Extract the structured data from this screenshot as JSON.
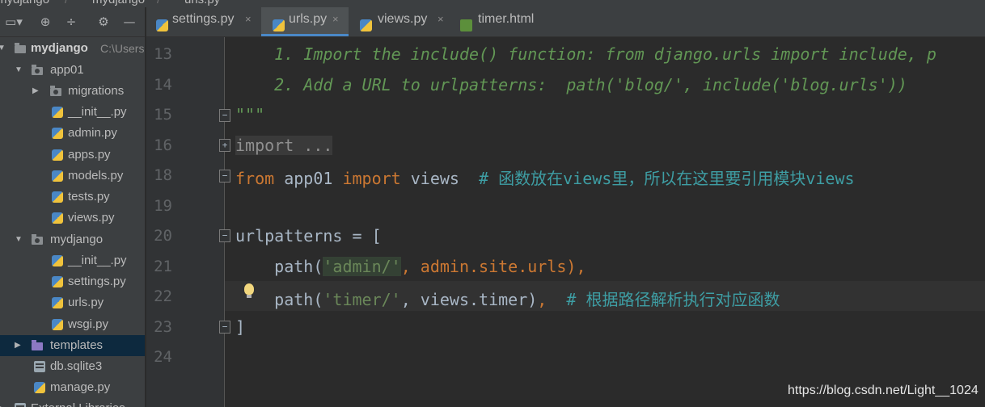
{
  "breadcrumb": [
    "mydjango",
    "mydjango",
    "urls.py"
  ],
  "project_toolbar": {
    "target_icon": "target-icon",
    "collapse_icon": "collapse-all-icon",
    "settings_icon": "gear-icon",
    "hide_icon": "minimize-icon"
  },
  "tree": [
    {
      "label": "mydjango",
      "extra": "C:\\Users",
      "type": "project-root",
      "icon": "folder-icon"
    },
    {
      "label": "app01",
      "type": "package",
      "icon": "package-folder-icon"
    },
    {
      "label": "migrations",
      "type": "package",
      "icon": "package-folder-icon"
    },
    {
      "label": "__init__.py",
      "type": "file",
      "icon": "python-file-icon"
    },
    {
      "label": "admin.py",
      "type": "file",
      "icon": "python-file-icon"
    },
    {
      "label": "apps.py",
      "type": "file",
      "icon": "python-file-icon"
    },
    {
      "label": "models.py",
      "type": "file",
      "icon": "python-file-icon"
    },
    {
      "label": "tests.py",
      "type": "file",
      "icon": "python-file-icon"
    },
    {
      "label": "views.py",
      "type": "file",
      "icon": "python-file-icon"
    },
    {
      "label": "mydjango",
      "type": "package",
      "icon": "package-folder-icon"
    },
    {
      "label": "__init__.py",
      "type": "file",
      "icon": "python-file-icon"
    },
    {
      "label": "settings.py",
      "type": "file",
      "icon": "python-file-icon"
    },
    {
      "label": "urls.py",
      "type": "file",
      "icon": "python-file-icon"
    },
    {
      "label": "wsgi.py",
      "type": "file",
      "icon": "python-file-icon"
    },
    {
      "label": "templates",
      "type": "folder",
      "icon": "templates-folder-icon"
    },
    {
      "label": "db.sqlite3",
      "type": "file",
      "icon": "database-file-icon"
    },
    {
      "label": "manage.py",
      "type": "file",
      "icon": "python-file-icon"
    },
    {
      "label": "External Libraries",
      "type": "folder",
      "icon": "library-icon"
    }
  ],
  "tabs": [
    {
      "label": "settings.py",
      "icon": "python-file-icon",
      "close": "×"
    },
    {
      "label": "urls.py",
      "icon": "python-file-icon",
      "close": "×",
      "active": true
    },
    {
      "label": "views.py",
      "icon": "python-file-icon",
      "close": "×"
    },
    {
      "label": "timer.html",
      "icon": "html-file-icon"
    }
  ],
  "editor": {
    "line_numbers": [
      "13",
      "14",
      "15",
      "16",
      "18",
      "19",
      "20",
      "21",
      "22",
      "23",
      "24"
    ],
    "lines": {
      "l13": "    1. Import the include() function: from django.urls import include, p",
      "l14": "    2. Add a URL to urlpatterns:  path('blog/', include('blog.urls'))",
      "l15": "\"\"\"",
      "l16": "import ...",
      "l18_kw1": "from",
      "l18_mod": " app01 ",
      "l18_kw2": "import",
      "l18_name": " views  ",
      "l18_comment": "# 函数放在views里，所以在这里要引用模块views",
      "l20": "urlpatterns = [",
      "l21_fn": "    path(",
      "l21_str": "'admin/'",
      "l21_rest": ", admin.site.urls",
      "l21_end": "),",
      "l22_fn": "    path(",
      "l22_str": "'timer/'",
      "l22_rest": ", views.timer)",
      "l22_comma": ",",
      "l22_comment": "  # 根据路径解析执行对应函数",
      "l23": "]"
    }
  },
  "watermark": "https://blog.csdn.net/Light__1024",
  "colors": {
    "background": "#2b2b2b",
    "panel": "#3c3f41",
    "keyword": "#cc7832",
    "string": "#6a8759",
    "comment": "#629755",
    "accent": "#4a88c7"
  }
}
